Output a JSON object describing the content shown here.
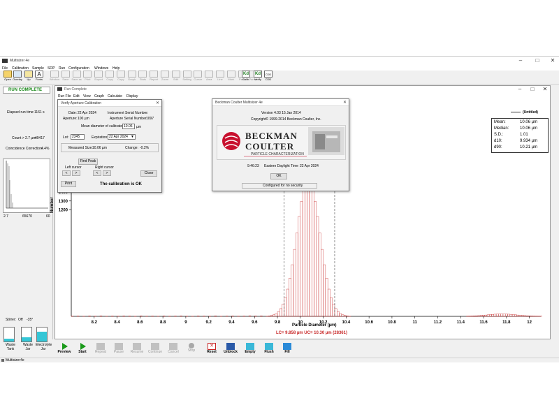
{
  "app": {
    "title": "Multisizer 4e",
    "menu": [
      "File",
      "Calibration",
      "Sample",
      "SOP",
      "Run",
      "Configuration",
      "Windows",
      "Help"
    ]
  },
  "toolbar": {
    "buttons": [
      {
        "label": "Open",
        "icon": "open-icon",
        "enabled": true
      },
      {
        "label": "Overlay",
        "icon": "overlay-icon",
        "enabled": true
      },
      {
        "label": "Up",
        "icon": "up-icon",
        "enabled": true
      },
      {
        "label": "Fonts",
        "icon": "fonts-icon",
        "enabled": true
      },
      {
        "label": "Window",
        "icon": "window-icon",
        "enabled": false
      },
      {
        "label": "Save",
        "icon": "save-icon",
        "enabled": false
      },
      {
        "label": "Save as",
        "icon": "save-as-icon",
        "enabled": false
      },
      {
        "label": "Print",
        "icon": "print-icon",
        "enabled": false
      },
      {
        "label": "Export",
        "icon": "export-icon",
        "enabled": false
      },
      {
        "label": "Copy",
        "icon": "copy-icon",
        "enabled": false
      },
      {
        "label": "Copy",
        "icon": "copy-graph-icon",
        "enabled": false
      },
      {
        "label": "Graph",
        "icon": "graph-icon",
        "enabled": false
      },
      {
        "label": "Stats",
        "icon": "stats-icon",
        "enabled": false
      },
      {
        "label": "Report",
        "icon": "report-icon",
        "enabled": false
      },
      {
        "label": "Zoom",
        "icon": "zoom-icon",
        "enabled": false
      },
      {
        "label": "Edit",
        "icon": "edit-icon",
        "enabled": false
      },
      {
        "label": "Setting",
        "icon": "settings-icon",
        "enabled": false
      },
      {
        "label": "Cursor",
        "icon": "cursor-icon",
        "enabled": false
      },
      {
        "label": "Area",
        "icon": "area-icon",
        "enabled": false
      },
      {
        "label": "Line",
        "icon": "line-icon",
        "enabled": false
      },
      {
        "label": "Mark",
        "icon": "mark-icon",
        "enabled": false
      },
      {
        "label": "Peak",
        "icon": "peak-icon",
        "enabled": false
      },
      {
        "label": "Param",
        "icon": "param-icon",
        "enabled": false
      },
      {
        "label": "Calib.",
        "icon": "kd-calib-icon",
        "enabled": true
      },
      {
        "label": "Verify",
        "icon": "kd-verify-icon",
        "enabled": true
      },
      {
        "label": "CDD",
        "icon": "cdd-icon",
        "enabled": true
      }
    ]
  },
  "left_panel": {
    "status": "RUN COMPLETE",
    "elapsed_label": "Elapsed run time:",
    "elapsed_value": "1161 s",
    "count_label": "Count > 2.7 µm:",
    "count_value": "49417",
    "coincidence_label": "Coincidence Correction:",
    "coincidence_value": "4.4%",
    "mini_axis": [
      "2.7",
      "65670",
      "60"
    ],
    "stirrer_label": "Stirrer:",
    "stirrer_value": "Off",
    "stirrer_angle": "-35°",
    "tanks": [
      {
        "label": "Waste Tank",
        "level": 0.2
      },
      {
        "label": "Waste Jar",
        "level": 0.3
      },
      {
        "label": "Electrolyte Jar",
        "level": 0.7
      }
    ]
  },
  "run_window": {
    "title": "Run Complete",
    "menu": [
      "Run File",
      "Edit",
      "View",
      "Graph",
      "Calculate",
      "Display"
    ],
    "legend": "(Untitled)",
    "stats": [
      {
        "label": "Mean:",
        "value": "10.06 µm"
      },
      {
        "label": "Median:",
        "value": "10.06 µm"
      },
      {
        "label": "S.D.:",
        "value": "1.01"
      },
      {
        "label": "d10:",
        "value": "9.934 µm"
      },
      {
        "label": "d90:",
        "value": "10.21 µm"
      }
    ],
    "cursor_text": "LC= 9.858 µm   UC= 10.30 µm (28361)"
  },
  "chart_data": {
    "type": "bar",
    "xlabel": "Particle Diameter (µm)",
    "ylabel": "Number",
    "xlim": [
      8.0,
      12.1
    ],
    "ylim": [
      0,
      1550
    ],
    "x_ticks": [
      "8.2",
      "8.4",
      "8.6",
      "8.8",
      "9",
      "9.2",
      "9.4",
      "9.6",
      "9.8",
      "10",
      "10.2",
      "10.4",
      "10.6",
      "10.8",
      "11",
      "11.2",
      "11.4",
      "11.6",
      "11.8",
      "12"
    ],
    "x_tick_values": [
      8.2,
      8.4,
      8.6,
      8.8,
      9.0,
      9.2,
      9.4,
      9.6,
      9.8,
      10.0,
      10.2,
      10.4,
      10.6,
      10.8,
      11.0,
      11.2,
      11.4,
      11.6,
      11.8,
      12.0
    ],
    "y_ticks": [
      1200,
      1300,
      1400
    ],
    "peak": {
      "center": 10.06,
      "sigma": 0.1,
      "max": 1550
    },
    "cursors": {
      "lower": 9.858,
      "upper": 10.3
    },
    "satellite": {
      "center": 11.75,
      "sigma": 0.12,
      "max": 25,
      "range": [
        11.45,
        12.1
      ]
    },
    "noise_range": [
      8.0,
      9.7
    ],
    "noise_values": [
      3,
      4,
      2,
      5,
      3,
      6,
      2,
      4,
      3,
      5,
      4,
      2,
      6,
      3,
      4,
      2,
      5,
      3,
      4,
      6,
      3,
      2,
      5,
      4,
      3,
      6,
      2,
      4,
      5,
      3,
      4,
      7,
      5,
      6
    ],
    "bin_width": 0.02,
    "color": "#c82828"
  },
  "verify_dialog": {
    "title": "Verify Aperture Calibration",
    "date_label": "Date:",
    "date_value": "22 Apr 2024",
    "serial_label": "Instrument Serial Number:",
    "aperture_label": "Aperture:",
    "aperture_value": "100 µm",
    "aperture_serial_label": "Aperture Serial Number:",
    "aperture_serial_value": "1097",
    "mean_diam_label": "Mean diameter of calibrator:",
    "mean_diam_value": "10.06",
    "mean_diam_unit": "µm",
    "lot_label": "Lot:",
    "lot_value": "2345",
    "expiration_label": "Expiration:",
    "expiration_value": "22 Apr 2024",
    "measured_label": "Measured Size:",
    "measured_value": "10.06 µm",
    "change_label": "Change:",
    "change_value": "-0.2%",
    "find_peak": "Find Peak",
    "left_cursor": "Left cursor",
    "right_cursor": "Right cursor",
    "close": "Close",
    "print": "Print",
    "result": "The calibration is OK"
  },
  "about_dialog": {
    "title": "Beckman Coulter Multisizer 4e",
    "version": "Version 4.03   15 Jan 2014",
    "copyright": "Copyright© 1999-2014 Beckman Coulter, Inc.",
    "brand_line1": "BECKMAN",
    "brand_line2": "COULTER",
    "tagline": "PARTICLE CHARACTERIZATION",
    "time": "9:46:23",
    "timezone": "Eastern Daylight Time",
    "date": "22 Apr 2024",
    "ok": "OK",
    "security": "Configured for no security"
  },
  "bottom_bar": {
    "buttons": [
      {
        "label": "Preview",
        "icon": "play-icon",
        "enabled": true
      },
      {
        "label": "Start",
        "icon": "start-icon",
        "enabled": true
      },
      {
        "label": "Repeat",
        "icon": "repeat-icon",
        "enabled": false
      },
      {
        "label": "Pause",
        "icon": "pause-icon",
        "enabled": false
      },
      {
        "label": "Resume",
        "icon": "resume-icon",
        "enabled": false
      },
      {
        "label": "Continue",
        "icon": "continue-icon",
        "enabled": false
      },
      {
        "label": "Cancel",
        "icon": "cancel-icon",
        "enabled": false
      },
      {
        "label": "Stop",
        "icon": "stop-icon",
        "enabled": false
      },
      {
        "label": "Reset",
        "icon": "reset-icon",
        "enabled": true
      },
      {
        "label": "Unblock",
        "icon": "unblock-icon",
        "enabled": true
      },
      {
        "label": "Empty",
        "icon": "empty-icon",
        "enabled": true
      },
      {
        "label": "Flush",
        "icon": "flush-icon",
        "enabled": true
      },
      {
        "label": "Fill",
        "icon": "fill-icon",
        "enabled": true
      }
    ]
  },
  "status_bar": {
    "text": "Multisizer4e"
  }
}
